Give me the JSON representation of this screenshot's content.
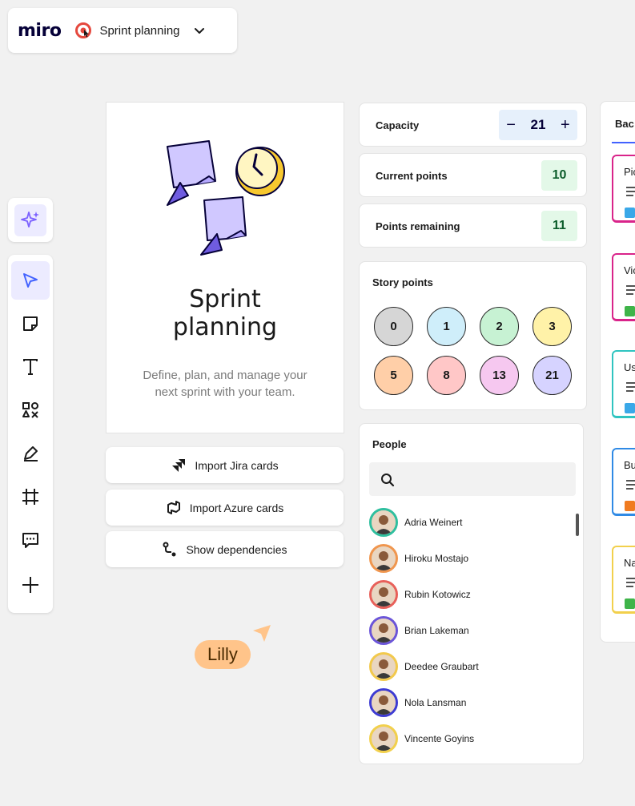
{
  "app": {
    "logo": "miro",
    "board_title": "Sprint planning"
  },
  "template": {
    "title_line1": "Sprint",
    "title_line2": "planning",
    "description_line1": "Define, plan, and manage your",
    "description_line2": "next sprint with your team."
  },
  "actions": {
    "import_jira": "Import Jira cards",
    "import_azure": "Import Azure cards",
    "show_dependencies": "Show dependencies"
  },
  "capacity": {
    "label": "Capacity",
    "value": "21",
    "minus": "−",
    "plus": "+",
    "current_label": "Current points",
    "current_value": "10",
    "remaining_label": "Points remaining",
    "remaining_value": "11"
  },
  "story_points": {
    "label": "Story points",
    "values": [
      "0",
      "1",
      "2",
      "3",
      "5",
      "8",
      "13",
      "21"
    ],
    "colors": [
      "#d6d6d6",
      "#cfeefa",
      "#c7f2d3",
      "#fff2a8",
      "#ffcfa8",
      "#ffc7c7",
      "#f6c8f0",
      "#d6d3ff"
    ]
  },
  "people": {
    "label": "People",
    "search_placeholder": "",
    "items": [
      {
        "name": "Adria Weinert",
        "ring": "#2fbf9f"
      },
      {
        "name": "Hiroku Mostajo",
        "ring": "#f0964e"
      },
      {
        "name": "Rubin Kotowicz",
        "ring": "#e8605a"
      },
      {
        "name": "Brian Lakeman",
        "ring": "#6b55d9"
      },
      {
        "name": "Deedee Graubart",
        "ring": "#f2c94c"
      },
      {
        "name": "Nola Lansman",
        "ring": "#3d3bd3"
      },
      {
        "name": "Vincente Goyins",
        "ring": "#f2d04c"
      }
    ]
  },
  "backlog": {
    "title": "Bac",
    "cards": [
      {
        "title": "Pic",
        "color": "#d9248a",
        "tag": "#3aa8e8"
      },
      {
        "title": "Vic",
        "color": "#d9248a",
        "tag": "#3fb449"
      },
      {
        "title": "Us",
        "color": "#2fc4c0",
        "tag": "#3aa8e8"
      },
      {
        "title": "Bu",
        "color": "#2f8ae5",
        "tag": "#f07b20"
      },
      {
        "title": "Na",
        "color": "#f2d04c",
        "tag": "#3fb449"
      }
    ]
  },
  "collaborator": {
    "name": "Lilly",
    "color": "#ffc48a"
  },
  "icons": {
    "toolbar": [
      "ai-sparkle-icon",
      "select-cursor-icon",
      "sticky-note-icon",
      "text-icon",
      "shapes-icon",
      "pen-icon",
      "frame-icon",
      "comment-icon",
      "add-icon"
    ]
  }
}
